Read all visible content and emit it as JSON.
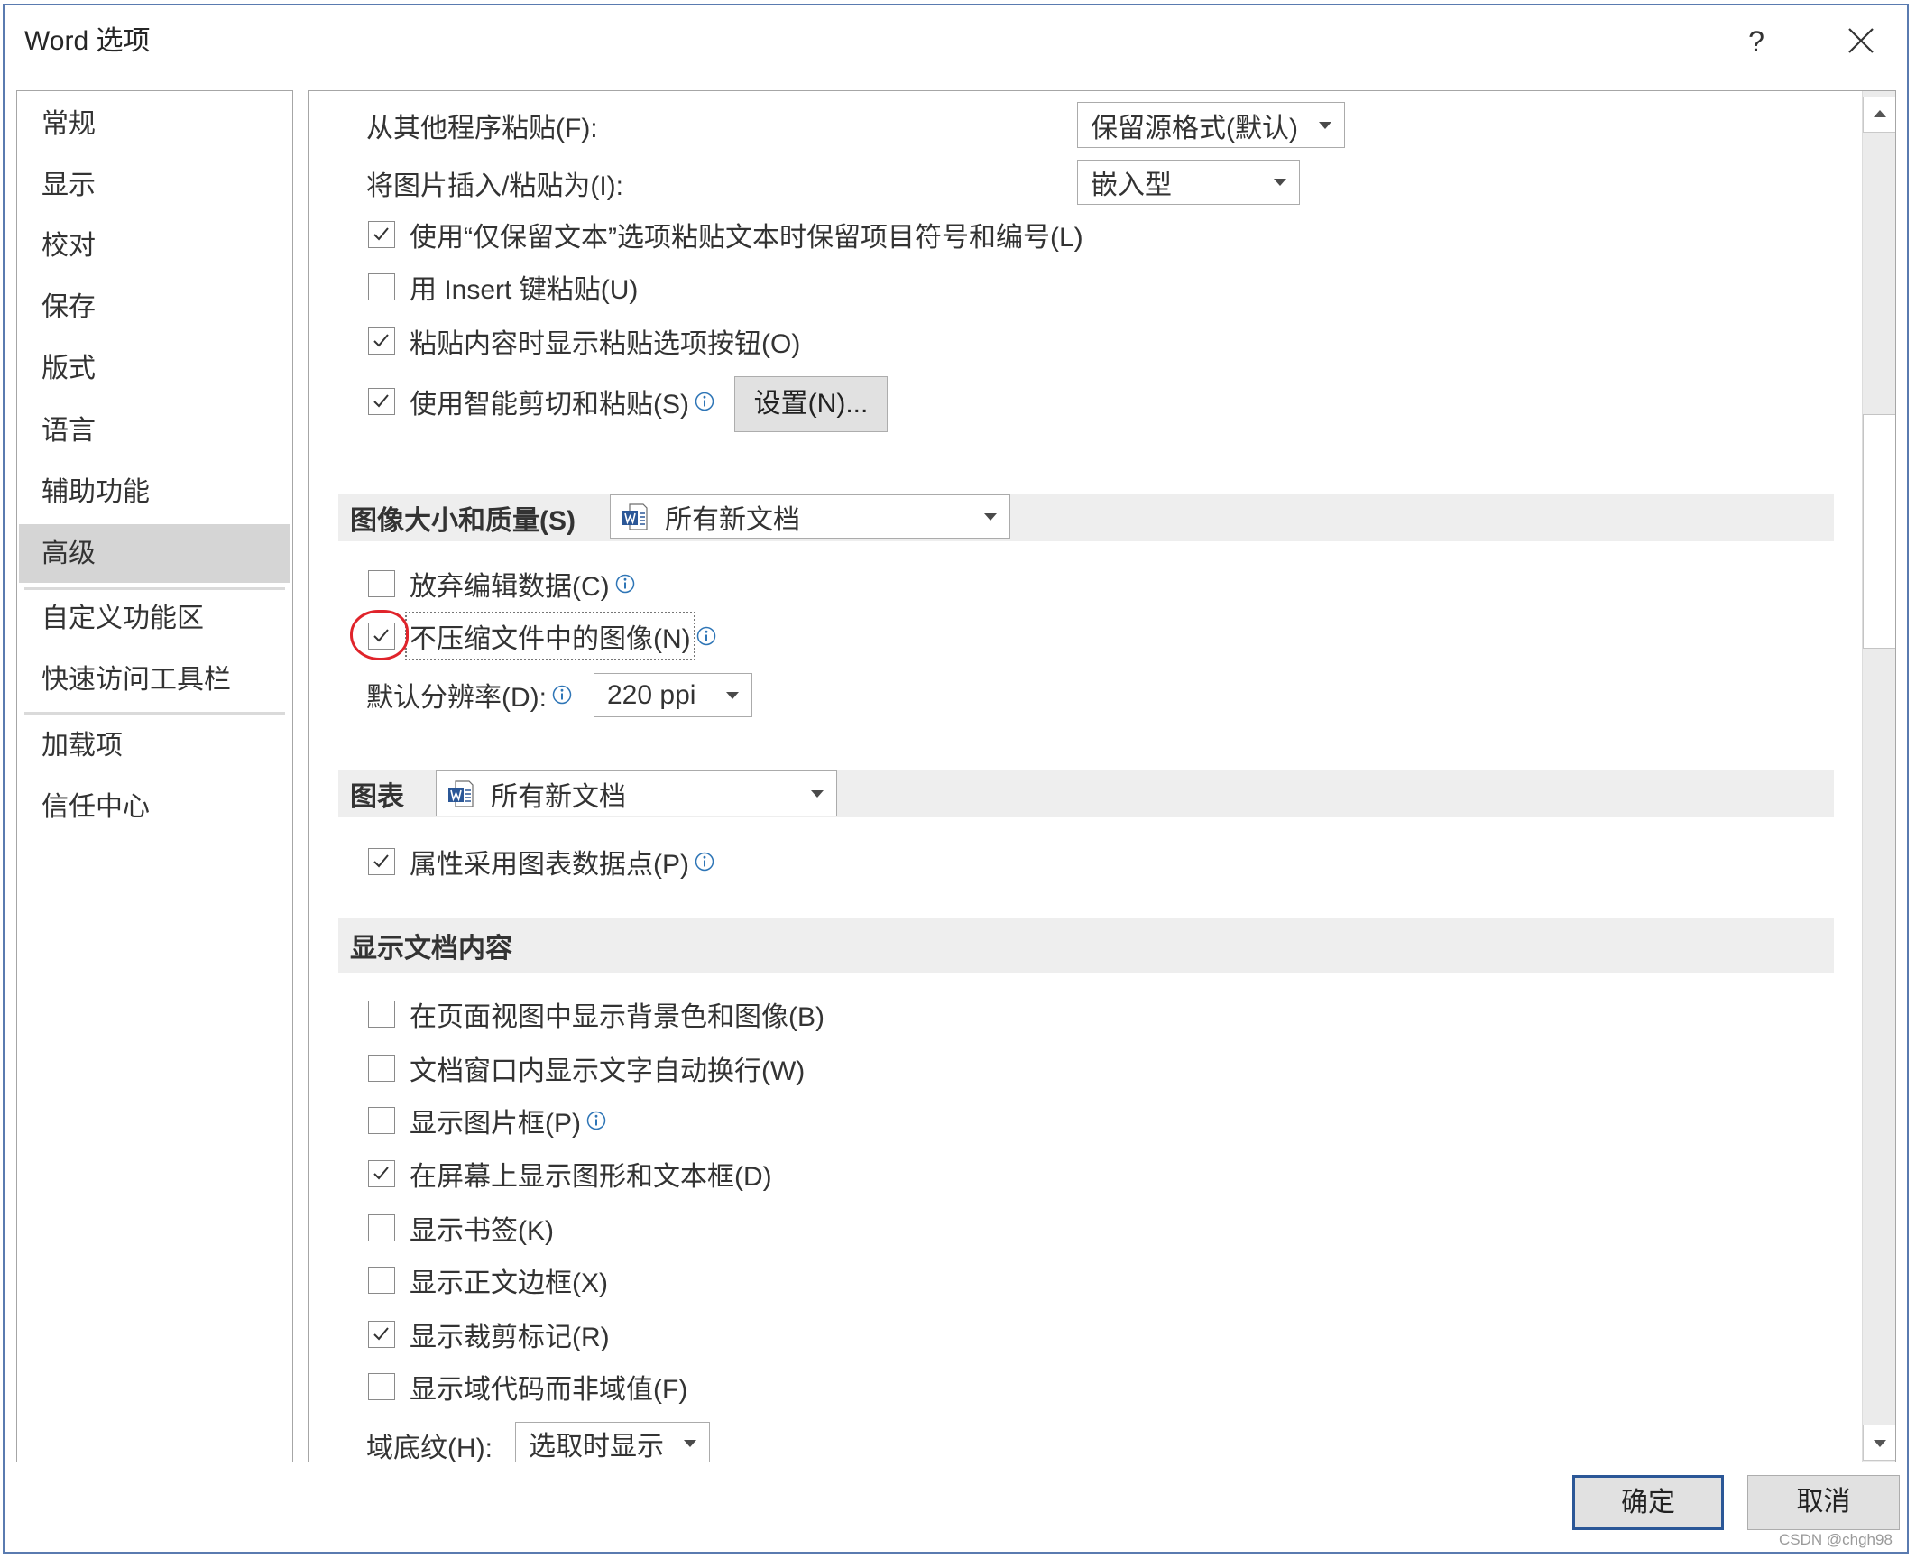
{
  "window": {
    "title": "Word 选项",
    "help": "?",
    "watermark": "CSDN @chgh98"
  },
  "colors": {
    "accent": "#2b5797",
    "annotation": "#e0242b",
    "info": "#2e75b6"
  },
  "sidebar": {
    "items": [
      {
        "label": "常规"
      },
      {
        "label": "显示"
      },
      {
        "label": "校对"
      },
      {
        "label": "保存"
      },
      {
        "label": "版式"
      },
      {
        "label": "语言"
      },
      {
        "label": "辅助功能"
      },
      {
        "label": "高级",
        "selected": true
      },
      {
        "label": "自定义功能区"
      },
      {
        "label": "快速访问工具栏"
      },
      {
        "label": "加载项"
      },
      {
        "label": "信任中心"
      }
    ]
  },
  "cut_copy_paste": {
    "paste_other": {
      "label": "从其他程序粘贴(F):",
      "value": "保留源格式(默认)"
    },
    "insert_picture": {
      "label": "将图片插入/粘贴为(I):",
      "value": "嵌入型"
    },
    "options": [
      {
        "label": "使用“仅保留文本”选项粘贴文本时保留项目符号和编号(L)",
        "checked": true
      },
      {
        "label": "用 Insert 键粘贴(U)",
        "checked": false
      },
      {
        "label": "粘贴内容时显示粘贴选项按钮(O)",
        "checked": true
      },
      {
        "label": "使用智能剪切和粘贴(S)",
        "checked": true
      }
    ],
    "settings_button": "设置(N)..."
  },
  "image_quality": {
    "title": "图像大小和质量(S)",
    "document": "所有新文档",
    "options": [
      {
        "label": "放弃编辑数据(C)",
        "checked": false
      },
      {
        "label": "不压缩文件中的图像(N)",
        "checked": true
      }
    ],
    "resolution": {
      "label": "默认分辨率(D):",
      "value": "220 ppi"
    }
  },
  "chart": {
    "title": "图表",
    "document": "所有新文档",
    "options": [
      {
        "label": "属性采用图表数据点(P)",
        "checked": true
      }
    ]
  },
  "show_document_content": {
    "title": "显示文档内容",
    "options": [
      {
        "label": "在页面视图中显示背景色和图像(B)",
        "checked": false
      },
      {
        "label": "文档窗口内显示文字自动换行(W)",
        "checked": false
      },
      {
        "label": "显示图片框(P)",
        "checked": false
      },
      {
        "label": "在屏幕上显示图形和文本框(D)",
        "checked": true
      },
      {
        "label": "显示书签(K)",
        "checked": false
      },
      {
        "label": "显示正文边框(X)",
        "checked": false
      },
      {
        "label": "显示裁剪标记(R)",
        "checked": true
      },
      {
        "label": "显示域代码而非域值(F)",
        "checked": false
      }
    ],
    "field_shading": {
      "label": "域底纹(H):",
      "value": "选取时显示"
    }
  },
  "buttons": {
    "ok": "确定",
    "cancel": "取消"
  }
}
